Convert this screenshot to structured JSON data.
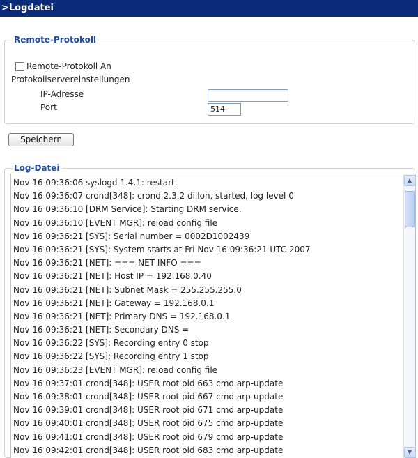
{
  "header": {
    "title": ">Logdatei"
  },
  "remote": {
    "legend": "Remote-Protokoll",
    "checkbox_label": "Remote-Protokoll An",
    "settings_label": "Protokollservereinstellungen",
    "ip_label": "IP-Adresse",
    "ip_value": "",
    "port_label": "Port",
    "port_value": "514"
  },
  "save_button": "Speichern",
  "log": {
    "legend": "Log-Datei",
    "lines": [
      "Nov 16 09:36:06 syslogd 1.4.1: restart.",
      "Nov 16 09:36:07 crond[348]: crond 2.3.2 dillon, started, log level 0",
      "Nov 16 09:36:10 [DRM Service]: Starting DRM service.",
      "Nov 16 09:36:10 [EVENT MGR]: reload config file",
      "Nov 16 09:36:21 [SYS]: Serial number = 0002D1002439",
      "Nov 16 09:36:21 [SYS]: System starts at Fri Nov 16 09:36:21 UTC 2007",
      "Nov 16 09:36:21 [NET]: === NET INFO ===",
      "Nov 16 09:36:21 [NET]: Host IP = 192.168.0.40",
      "Nov 16 09:36:21 [NET]: Subnet Mask = 255.255.255.0",
      "Nov 16 09:36:21 [NET]: Gateway = 192.168.0.1",
      "Nov 16 09:36:21 [NET]: Primary DNS = 192.168.0.1",
      "Nov 16 09:36:21 [NET]: Secondary DNS =",
      "Nov 16 09:36:22 [SYS]: Recording entry 0 stop",
      "Nov 16 09:36:22 [SYS]: Recording entry 1 stop",
      "Nov 16 09:36:23 [EVENT MGR]: reload config file",
      "Nov 16 09:37:01 crond[348]: USER root pid 663 cmd arp-update",
      "Nov 16 09:38:01 crond[348]: USER root pid 667 cmd arp-update",
      "Nov 16 09:39:01 crond[348]: USER root pid 671 cmd arp-update",
      "Nov 16 09:40:01 crond[348]: USER root pid 675 cmd arp-update",
      "Nov 16 09:41:01 crond[348]: USER root pid 679 cmd arp-update",
      "Nov 16 09:42:01 crond[348]: USER root pid 683 cmd arp-update"
    ]
  },
  "icons": {
    "scroll_up": "chevron-up-icon",
    "scroll_down": "chevron-down-icon"
  },
  "colors": {
    "title_bg": "#0a2a7a",
    "legend": "#1f4f9e"
  }
}
